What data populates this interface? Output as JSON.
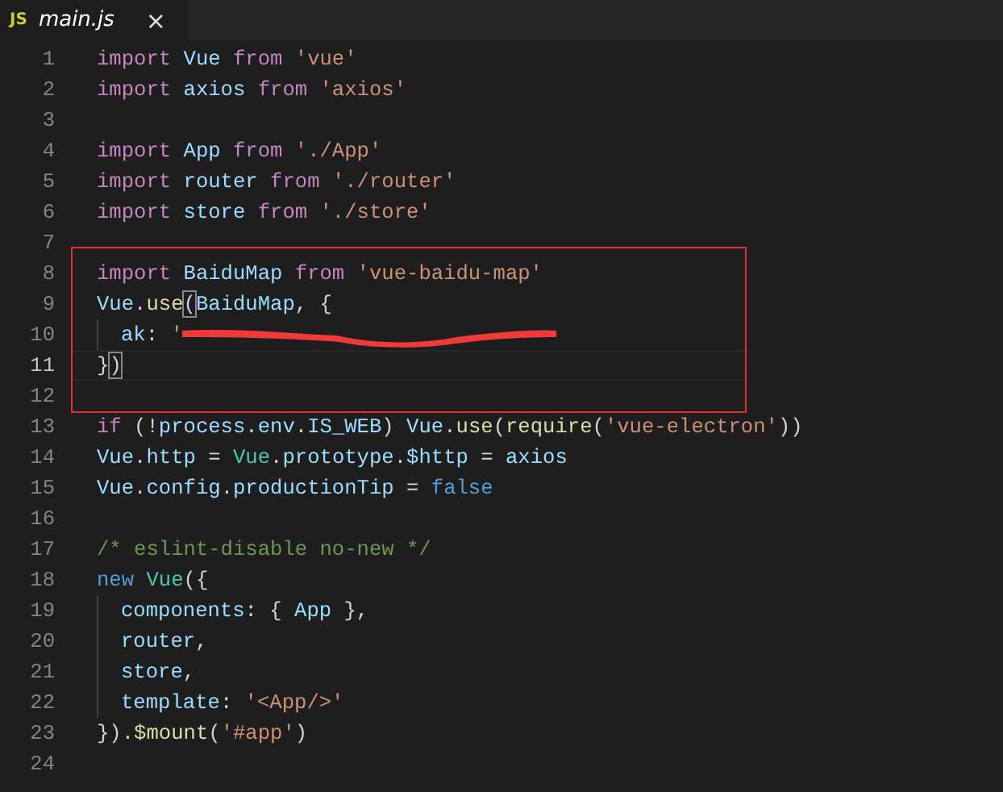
{
  "tabs": [
    {
      "icon": "JS",
      "label": "main.js",
      "close": "×",
      "selected": true,
      "preview": true
    }
  ],
  "editor": {
    "lines": [
      {
        "number": "1",
        "tokens": [
          {
            "text": "import ",
            "kind": "keyword"
          },
          {
            "text": "Vue ",
            "kind": "variable"
          },
          {
            "text": "from ",
            "kind": "keyword"
          },
          {
            "text": "'vue'",
            "kind": "string"
          }
        ]
      },
      {
        "number": "2",
        "tokens": [
          {
            "text": "import ",
            "kind": "keyword"
          },
          {
            "text": "axios ",
            "kind": "variable"
          },
          {
            "text": "from ",
            "kind": "keyword"
          },
          {
            "text": "'axios'",
            "kind": "string"
          }
        ]
      },
      {
        "number": "3"
      },
      {
        "number": "4",
        "tokens": [
          {
            "text": "import ",
            "kind": "keyword"
          },
          {
            "text": "App ",
            "kind": "variable"
          },
          {
            "text": "from ",
            "kind": "keyword"
          },
          {
            "text": "'./App'",
            "kind": "string"
          }
        ]
      },
      {
        "number": "5",
        "tokens": [
          {
            "text": "import ",
            "kind": "keyword"
          },
          {
            "text": "router ",
            "kind": "variable"
          },
          {
            "text": "from ",
            "kind": "keyword"
          },
          {
            "text": "'./router'",
            "kind": "string"
          }
        ]
      },
      {
        "number": "6",
        "tokens": [
          {
            "text": "import ",
            "kind": "keyword"
          },
          {
            "text": "store ",
            "kind": "variable"
          },
          {
            "text": "from ",
            "kind": "keyword"
          },
          {
            "text": "'./store'",
            "kind": "string"
          }
        ]
      },
      {
        "number": "7"
      },
      {
        "number": "8",
        "annotated": true,
        "tokens": [
          {
            "text": "import ",
            "kind": "keyword"
          },
          {
            "text": "BaiduMap ",
            "kind": "variable"
          },
          {
            "text": "from ",
            "kind": "keyword"
          },
          {
            "text": "'vue-baidu-map'",
            "kind": "string"
          }
        ]
      },
      {
        "number": "9",
        "annotated": true,
        "tokens": [
          {
            "text": "Vue",
            "kind": "variable"
          },
          {
            "text": ".",
            "kind": "plain"
          },
          {
            "text": "use",
            "kind": "function"
          },
          {
            "text": "(",
            "kind": "plain",
            "matched": true
          },
          {
            "text": "BaiduMap",
            "kind": "variable"
          },
          {
            "text": ", {",
            "kind": "plain"
          }
        ]
      },
      {
        "number": "10",
        "annotated": true,
        "indent": true,
        "redacted": true,
        "tokens": [
          {
            "text": "ak",
            "kind": "variable"
          },
          {
            "text": ": ",
            "kind": "plain"
          },
          {
            "text": "'",
            "kind": "string"
          }
        ]
      },
      {
        "number": "11",
        "annotated": true,
        "current": true,
        "tokens": [
          {
            "text": "}",
            "kind": "plain"
          },
          {
            "text": ")",
            "kind": "plain",
            "matched": true
          }
        ]
      },
      {
        "number": "12",
        "annotated": true
      },
      {
        "number": "13",
        "tokens": [
          {
            "text": "if ",
            "kind": "keyword"
          },
          {
            "text": "(!",
            "kind": "plain"
          },
          {
            "text": "process",
            "kind": "variable"
          },
          {
            "text": ".",
            "kind": "plain"
          },
          {
            "text": "env",
            "kind": "variable"
          },
          {
            "text": ".",
            "kind": "plain"
          },
          {
            "text": "IS_WEB",
            "kind": "variable"
          },
          {
            "text": ") ",
            "kind": "plain"
          },
          {
            "text": "Vue",
            "kind": "variable"
          },
          {
            "text": ".",
            "kind": "plain"
          },
          {
            "text": "use",
            "kind": "function"
          },
          {
            "text": "(",
            "kind": "plain"
          },
          {
            "text": "require",
            "kind": "function"
          },
          {
            "text": "(",
            "kind": "plain"
          },
          {
            "text": "'vue-electron'",
            "kind": "string"
          },
          {
            "text": "))",
            "kind": "plain"
          }
        ]
      },
      {
        "number": "14",
        "tokens": [
          {
            "text": "Vue",
            "kind": "variable"
          },
          {
            "text": ".",
            "kind": "plain"
          },
          {
            "text": "http",
            "kind": "variable"
          },
          {
            "text": " = ",
            "kind": "plain"
          },
          {
            "text": "Vue",
            "kind": "class"
          },
          {
            "text": ".",
            "kind": "plain"
          },
          {
            "text": "prototype",
            "kind": "variable"
          },
          {
            "text": ".",
            "kind": "plain"
          },
          {
            "text": "$http",
            "kind": "variable"
          },
          {
            "text": " = ",
            "kind": "plain"
          },
          {
            "text": "axios",
            "kind": "variable"
          }
        ]
      },
      {
        "number": "15",
        "tokens": [
          {
            "text": "Vue",
            "kind": "variable"
          },
          {
            "text": ".",
            "kind": "plain"
          },
          {
            "text": "config",
            "kind": "variable"
          },
          {
            "text": ".",
            "kind": "plain"
          },
          {
            "text": "productionTip",
            "kind": "variable"
          },
          {
            "text": " = ",
            "kind": "plain"
          },
          {
            "text": "false",
            "kind": "constant"
          }
        ]
      },
      {
        "number": "16"
      },
      {
        "number": "17",
        "tokens": [
          {
            "text": "/* eslint-disable no-new */",
            "kind": "comment"
          }
        ]
      },
      {
        "number": "18",
        "tokens": [
          {
            "text": "new ",
            "kind": "constant"
          },
          {
            "text": "Vue",
            "kind": "class"
          },
          {
            "text": "({",
            "kind": "plain"
          }
        ]
      },
      {
        "number": "19",
        "indent": true,
        "tokens": [
          {
            "text": "components",
            "kind": "variable"
          },
          {
            "text": ": { ",
            "kind": "plain"
          },
          {
            "text": "App",
            "kind": "variable"
          },
          {
            "text": " },",
            "kind": "plain"
          }
        ]
      },
      {
        "number": "20",
        "indent": true,
        "tokens": [
          {
            "text": "router",
            "kind": "variable"
          },
          {
            "text": ",",
            "kind": "plain"
          }
        ]
      },
      {
        "number": "21",
        "indent": true,
        "tokens": [
          {
            "text": "store",
            "kind": "variable"
          },
          {
            "text": ",",
            "kind": "plain"
          }
        ]
      },
      {
        "number": "22",
        "indent": true,
        "tokens": [
          {
            "text": "template",
            "kind": "variable"
          },
          {
            "text": ": ",
            "kind": "plain"
          },
          {
            "text": "'<App/>'",
            "kind": "string"
          }
        ]
      },
      {
        "number": "23",
        "tokens": [
          {
            "text": "})",
            "kind": "plain"
          },
          {
            "text": ".",
            "kind": "plain"
          },
          {
            "text": "$mount",
            "kind": "function"
          },
          {
            "text": "(",
            "kind": "plain"
          },
          {
            "text": "'#app'",
            "kind": "string"
          },
          {
            "text": ")",
            "kind": "plain"
          }
        ]
      },
      {
        "number": "24"
      }
    ]
  }
}
